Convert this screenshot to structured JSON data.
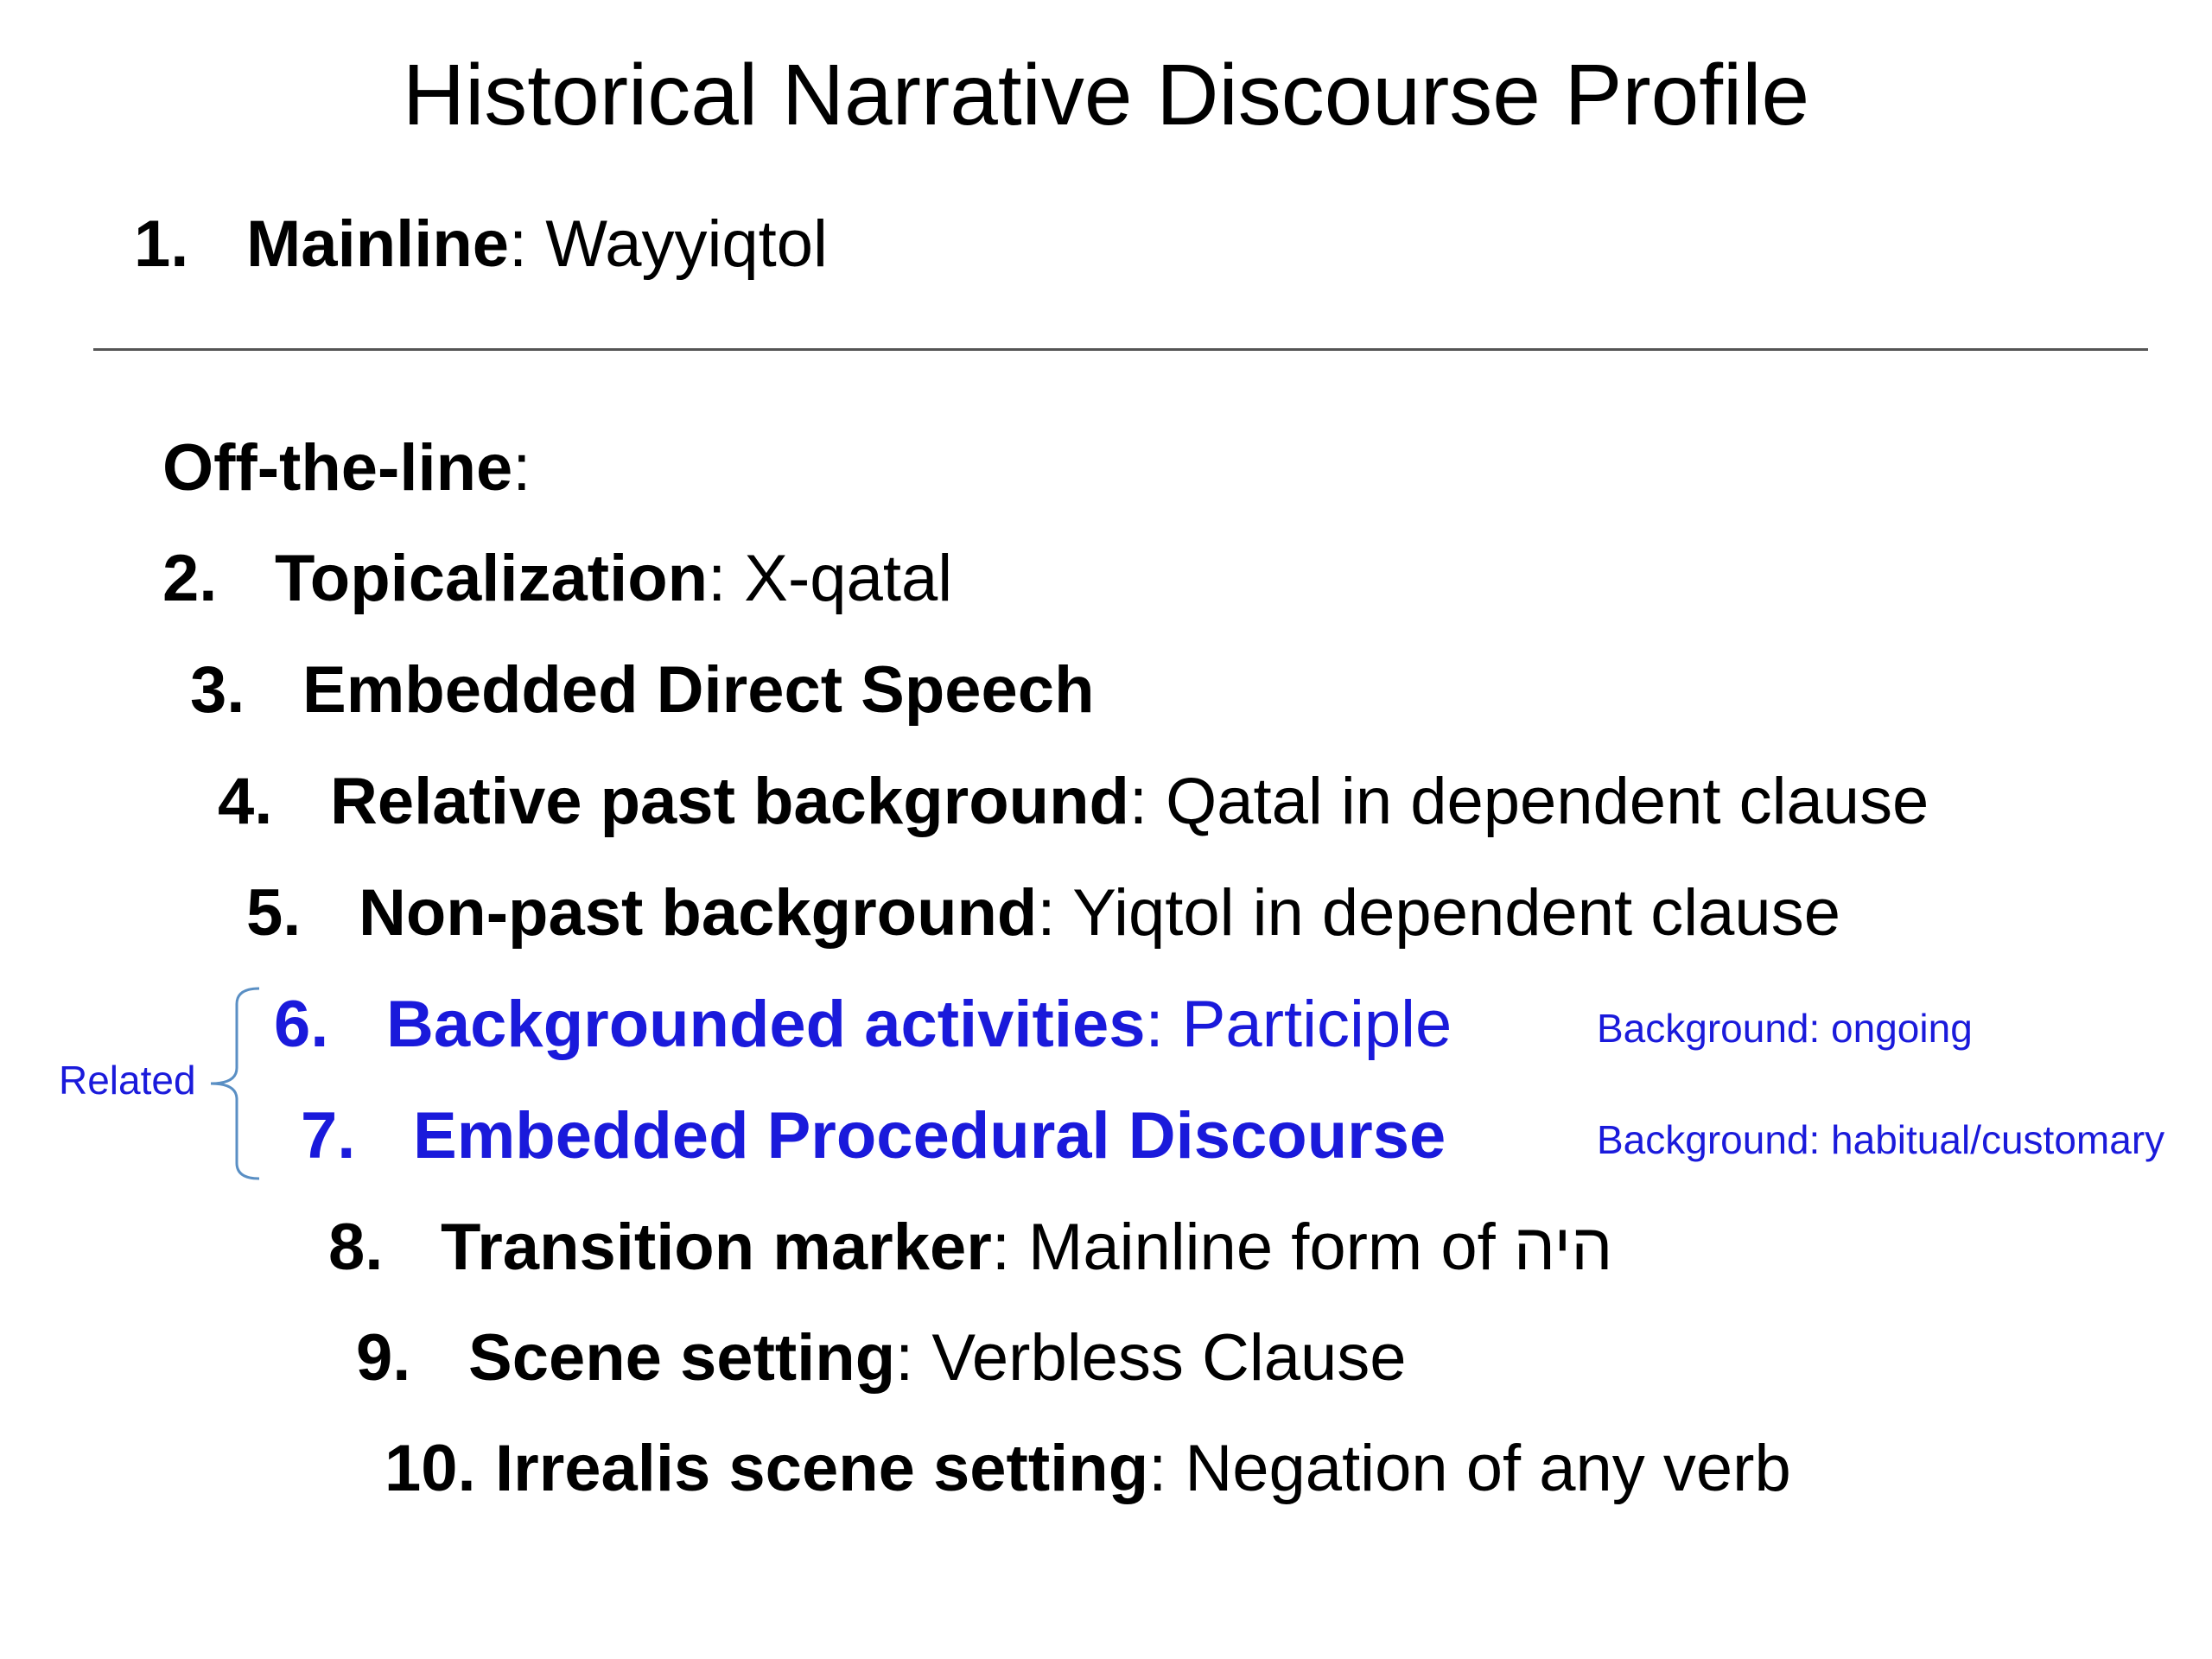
{
  "slide": {
    "title": "Historical Narrative Discourse Profile"
  },
  "mainline": {
    "number": "1.",
    "term": "Mainline",
    "colon": ":",
    "value": " Wayyiqtol"
  },
  "offline": {
    "heading": "Off-the-line",
    "colon": ":"
  },
  "items": [
    {
      "number": "2.",
      "term": "Topicalization",
      "colon": ":",
      "value": " X-qatal"
    },
    {
      "number": "3.",
      "term": "Embedded Direct Speech",
      "colon": "",
      "value": ""
    },
    {
      "number": "4.",
      "term": "Relative past background",
      "colon": ":",
      "value": " Qatal in dependent clause"
    },
    {
      "number": "5.",
      "term": "Non-past background",
      "colon": ":",
      "value": " Yiqtol in dependent clause"
    },
    {
      "number": "6.",
      "term": "Backgrounded activities",
      "colon": ":",
      "value": " Participle"
    },
    {
      "number": "7.",
      "term": "Embedded Procedural Discourse",
      "colon": "",
      "value": ""
    },
    {
      "number": "8.",
      "term": "Transition marker",
      "colon": ":",
      "value": " Mainline form of היה"
    },
    {
      "number": "9.",
      "term": "Scene setting",
      "colon": ":",
      "value": " Verbless Clause"
    },
    {
      "number": "10.",
      "term": "Irrealis scene setting",
      "colon": ":",
      "value": " Negation of any verb"
    }
  ],
  "notes": {
    "item6": "Background: ongoing",
    "item7": "Background: habitual/customary",
    "related": "Related"
  },
  "colors": {
    "highlight": "#1a1adb",
    "text": "#000000",
    "divider": "#555555"
  }
}
